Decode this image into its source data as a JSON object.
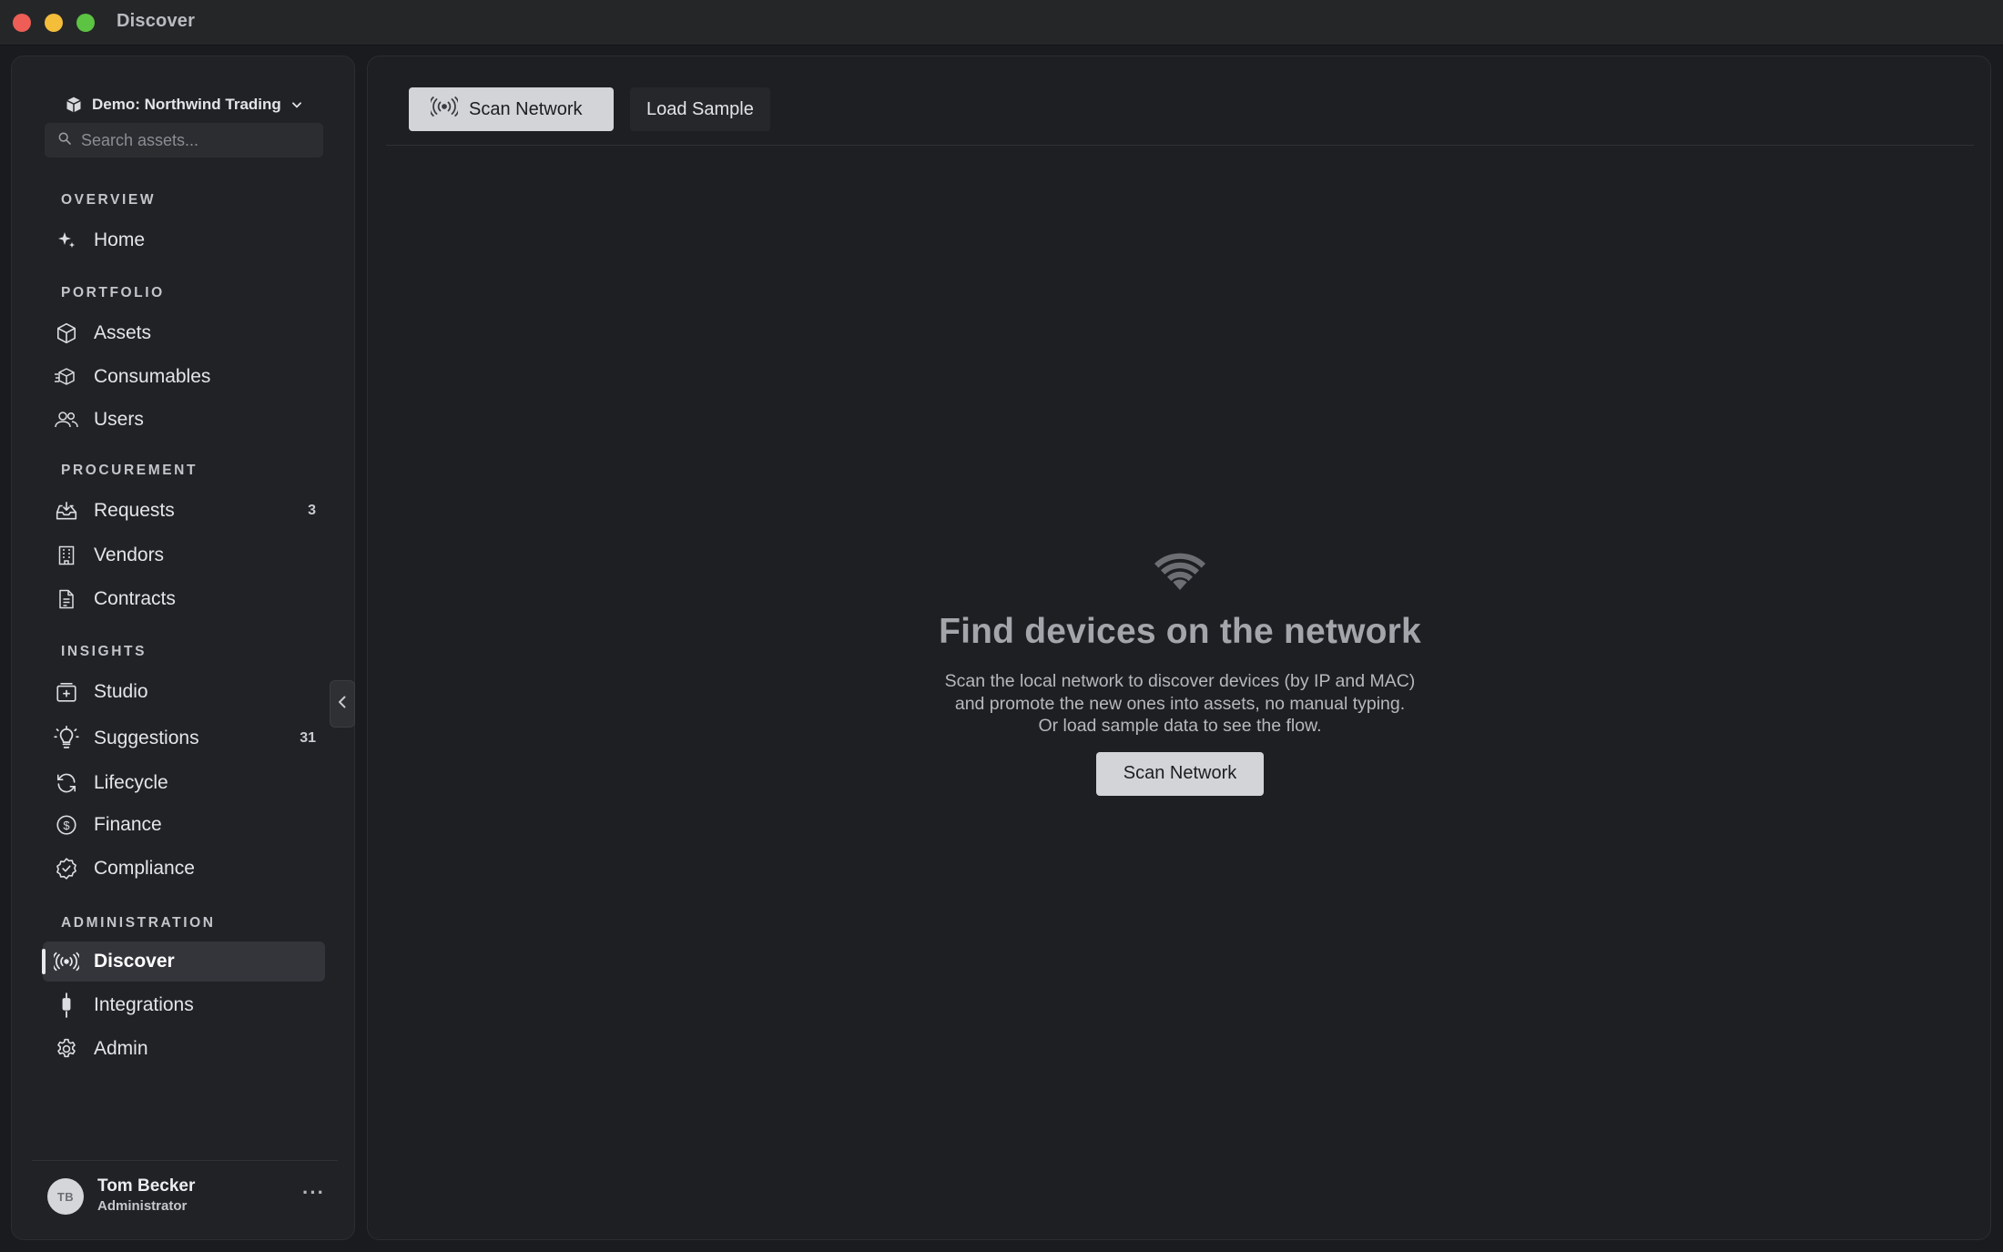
{
  "window": {
    "title": "Discover"
  },
  "sidebar": {
    "org_name": "Demo: Northwind Trading",
    "search_placeholder": "Search assets...",
    "sections": {
      "overview": "OVERVIEW",
      "portfolio": "PORTFOLIO",
      "procurement": "PROCUREMENT",
      "insights": "INSIGHTS",
      "administration": "ADMINISTRATION"
    },
    "items": {
      "home": "Home",
      "assets": "Assets",
      "consumables": "Consumables",
      "users": "Users",
      "requests": "Requests",
      "requests_count": "3",
      "vendors": "Vendors",
      "contracts": "Contracts",
      "studio": "Studio",
      "suggestions": "Suggestions",
      "suggestions_count": "31",
      "lifecycle": "Lifecycle",
      "finance": "Finance",
      "compliance": "Compliance",
      "discover": "Discover",
      "integrations": "Integrations",
      "admin": "Admin"
    },
    "active_item": "discover",
    "user": {
      "initials": "TB",
      "name": "Tom Becker",
      "role": "Administrator",
      "more": "···"
    }
  },
  "main": {
    "toolbar": {
      "scan_label": "Scan Network",
      "sample_label": "Load Sample"
    },
    "empty_state": {
      "icon": "wifi-icon",
      "title": "Find devices on the network",
      "description_lines": [
        "Scan the local network to discover devices (by IP and MAC)",
        "and promote the new ones into assets, no manual typing.",
        "Or load sample data to see the flow."
      ],
      "button_label": "Scan Network"
    }
  },
  "colors": {
    "background": "#1a1b1e",
    "sidebar": "#212226",
    "panel": "#1e1f22",
    "primary_button": "#d2d4d8",
    "active_item": "#33353a"
  }
}
